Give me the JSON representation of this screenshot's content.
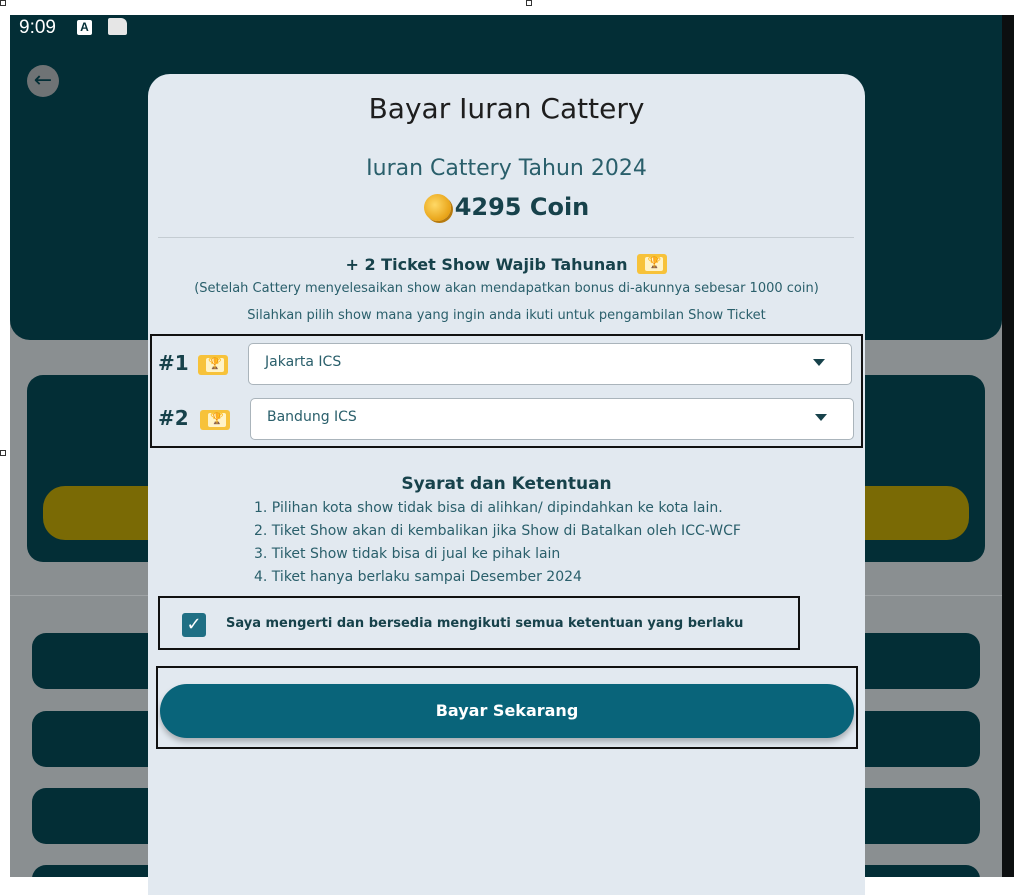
{
  "status_bar": {
    "time": "9:09",
    "indicator": "A"
  },
  "modal": {
    "title": "Bayar Iuran Cattery",
    "fee_title": "Iuran Cattery Tahun 2024",
    "price": "4295 Coin",
    "ticket_heading": "+ 2 Ticket Show Wajib Tahunan",
    "ticket_note": "(Setelah Cattery menyelesaikan show akan mendapatkan bonus di-akunnya sebesar 1000 coin)",
    "ticket_instruction": "Silahkan pilih show mana yang ingin anda ikuti untuk pengambilan Show Ticket",
    "shows": [
      {
        "number": "#1",
        "selected": "Jakarta ICS"
      },
      {
        "number": "#2",
        "selected": "Bandung ICS"
      }
    ],
    "terms_title": "Syarat dan Ketentuan",
    "terms": [
      "1. Pilihan kota show tidak bisa di alihkan/ dipindahkan ke kota lain.",
      "2. Tiket Show akan di kembalikan jika Show di Batalkan oleh ICC-WCF",
      "3. Tiket Show tidak bisa di jual ke pihak lain",
      "4. Tiket hanya berlaku sampai Desember 2024"
    ],
    "agreement": "Saya mengerti dan bersedia mengikuti semua ketentuan yang berlaku",
    "agreement_checked": true,
    "pay_button": "Bayar Sekarang"
  },
  "icons": {
    "back": "arrow-left-icon",
    "coin": "coin-icon",
    "ticket": "ticket-icon",
    "dropdown": "chevron-down-icon",
    "check": "check-icon"
  },
  "colors": {
    "primary": "#09647a",
    "text_dark": "#17424b",
    "text_teal": "#2a5f6b",
    "modal_bg": "#e2e9f0",
    "coin": "#e8a317",
    "ticket": "#f7c23a"
  }
}
